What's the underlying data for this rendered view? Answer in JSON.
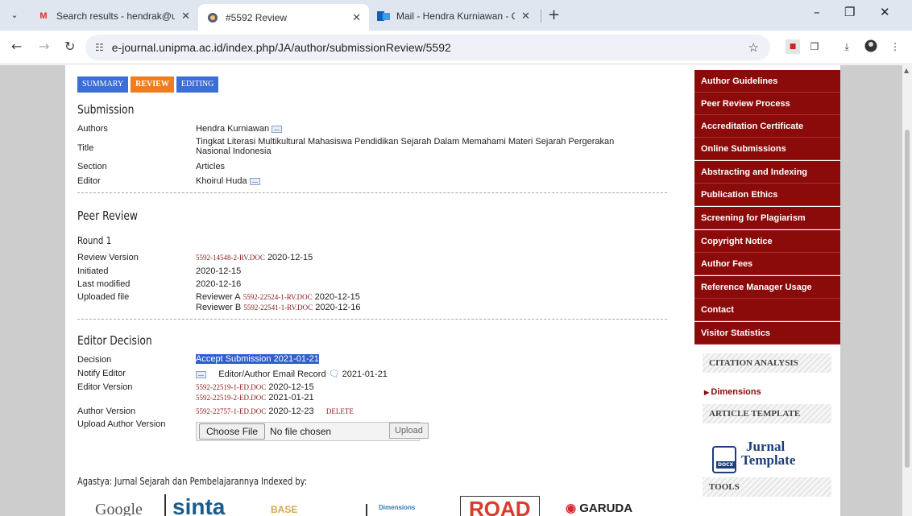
{
  "browser": {
    "tabs": [
      {
        "title": "Search results - hendrak@upi.e"
      },
      {
        "title": "#5592 Review"
      },
      {
        "title": "Mail - Hendra Kurniawan - Outl"
      }
    ],
    "url": "e-journal.unipma.ac.id/index.php/JA/author/submissionReview/5592"
  },
  "page": {
    "tabs": {
      "summary": "SUMMARY",
      "review": "REVIEW",
      "editing": "EDITING"
    },
    "submission": {
      "heading": "Submission",
      "authors_label": "Authors",
      "authors": "Hendra Kurniawan",
      "title_label": "Title",
      "title": "Tingkat Literasi Multikultural Mahasiswa Pendidikan Sejarah Dalam Memahami Materi Sejarah Pergerakan Nasional Indonesia",
      "section_label": "Section",
      "section": "Articles",
      "editor_label": "Editor",
      "editor": "Khoirul Huda"
    },
    "peer_review": {
      "heading": "Peer Review",
      "round": "Round 1",
      "review_version_label": "Review Version",
      "review_version_file": "5592-14548-2-RV.DOC",
      "review_version_date": "2020-12-15",
      "initiated_label": "Initiated",
      "initiated": "2020-12-15",
      "last_modified_label": "Last modified",
      "last_modified": "2020-12-16",
      "uploaded_label": "Uploaded file",
      "reviewer_a": "Reviewer A",
      "reviewer_a_file": "5592-22524-1-RV.DOC",
      "reviewer_a_date": "2020-12-15",
      "reviewer_b": "Reviewer B",
      "reviewer_b_file": "5592-22541-1-RV.DOC",
      "reviewer_b_date": "2020-12-16"
    },
    "editor_decision": {
      "heading": "Editor Decision",
      "decision_label": "Decision",
      "decision": "Accept Submission 2021-01-21",
      "notify_label": "Notify Editor",
      "notify_record": "Editor/Author Email Record",
      "notify_date": "2021-01-21",
      "editor_version_label": "Editor Version",
      "ev1_file": "5592-22519-1-ED.DOC",
      "ev1_date": "2020-12-15",
      "ev2_file": "5592-22519-2-ED.DOC",
      "ev2_date": "2021-01-21",
      "author_version_label": "Author Version",
      "av_file": "5592-22757-1-ED.DOC",
      "av_date": "2020-12-23",
      "delete": "DELETE",
      "upload_label": "Upload Author Version",
      "choose_file": "Choose File",
      "no_file": "No file chosen",
      "upload": "Upload"
    },
    "indexed_by": "Agastya: Jurnal Sejarah dan Pembelajarannya Indexed by:",
    "logos": [
      "Google",
      "sinta",
      "BASE",
      "Dimensions",
      "ROAD",
      "GARUDA"
    ]
  },
  "sidebar": {
    "menu": [
      "Author Guidelines",
      "Peer Review Process",
      "Accreditation Certificate",
      "Online Submissions",
      "Abstracting and Indexing",
      "Publication Ethics",
      "Screening for Plagiarism",
      "Copyright Notice",
      "Author Fees",
      "Reference Manager Usage",
      "Contact",
      "Visitor Statistics"
    ],
    "citation_analysis": "CITATION ANALYSIS",
    "dimensions": "Dimensions",
    "article_template": "ARTICLE TEMPLATE",
    "template_line1": "Jurnal",
    "template_line2": "Template",
    "docx": "DOCX",
    "tools": "TOOLS"
  }
}
